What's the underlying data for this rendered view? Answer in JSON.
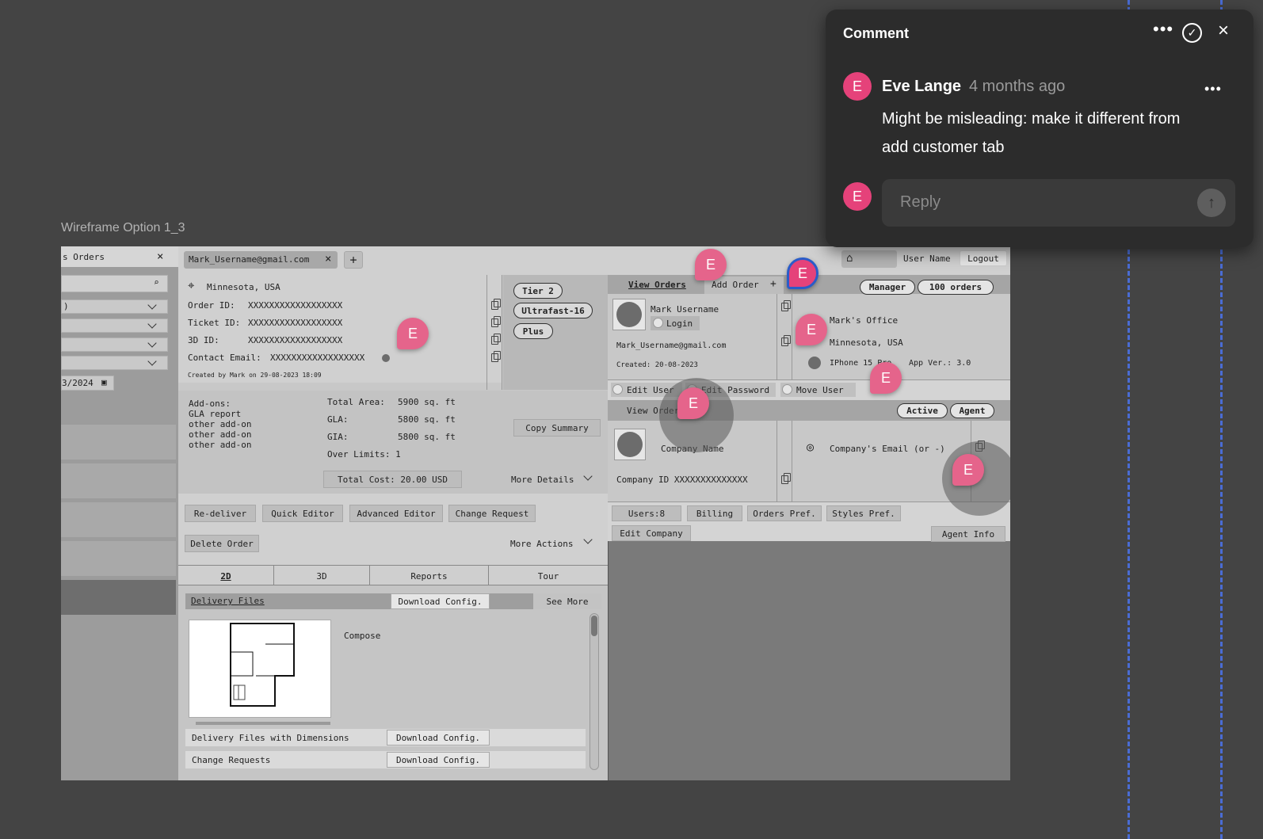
{
  "frame_label": "Wireframe Option 1_3",
  "left_panel": {
    "tab_label": "s Orders",
    "close": "×",
    "dropdown1": ")",
    "date": "3/2024"
  },
  "top": {
    "email_tab": "Mark_Username@gmail.com",
    "close": "×",
    "plus": "+",
    "user_name": "User Name",
    "logout": "Logout"
  },
  "order": {
    "location": "Minnesota, USA",
    "order_id_label": "Order ID:",
    "order_id": "XXXXXXXXXXXXXXXXXX",
    "ticket_label": "Ticket ID:",
    "ticket_id": "XXXXXXXXXXXXXXXXXX",
    "id3d_label": "3D ID:",
    "id3d": "XXXXXXXXXXXXXXXXXX",
    "email_label": "Contact Email:",
    "email": "XXXXXXXXXXXXXXXXXX",
    "created": "Created by Mark on 29-08-2023 18:09"
  },
  "badges": {
    "tier": "Tier 2",
    "speed": "Ultrafast-16",
    "plus": "Plus"
  },
  "summary": {
    "addons": [
      "Add-ons:",
      "GLA report",
      "other add-on",
      "other add-on",
      "other add-on"
    ],
    "total_area_label": "Total Area:",
    "total_area": "5900 sq. ft",
    "gla_label": "GLA:",
    "gla": "5800 sq. ft",
    "gia_label": "GIA:",
    "gia": "5800 sq. ft",
    "over_limits": "Over Limits: 1",
    "total_cost": "Total Cost: 20.00 USD",
    "copy_summary": "Copy Summary",
    "more_details": "More Details"
  },
  "actions": {
    "redeliver": "Re-deliver",
    "quick": "Quick Editor",
    "advanced": "Advanced Editor",
    "change": "Change Request",
    "delete": "Delete Order",
    "more": "More Actions"
  },
  "tabs": [
    "2D",
    "3D",
    "Reports",
    "Tour"
  ],
  "delivery": {
    "title": "Delivery Files",
    "download": "Download Config.",
    "see_more": "See More",
    "compose": "Compose",
    "dims_label": "Delivery Files with Dimensions",
    "dims_btn": "Download Config.",
    "change_label": "Change Requests",
    "change_btn": "Download Config."
  },
  "user": {
    "view_orders": "View Orders",
    "add_order": "Add Order",
    "add_icon": "+",
    "manager": "Manager",
    "orders": "100 orders",
    "name": "Mark Username",
    "login": "Login",
    "email": "Mark_Username@gmail.com",
    "created": "Created: 20-08-2023",
    "office": "Mark's Office",
    "location": "Minnesota, USA",
    "device": "IPhone 15 Pro",
    "app": "App Ver.: 3.0",
    "edit_user": "Edit User",
    "edit_password": "Edit Password",
    "move_user": "Move User"
  },
  "company": {
    "view_orders": "View Orders",
    "active": "Active",
    "agent": "Agent",
    "name": "Company Name",
    "email": "Company's Email (or -)",
    "id": "Company ID XXXXXXXXXXXXXX",
    "users": "Users:8",
    "billing": "Billing",
    "orders_pref": "Orders Pref.",
    "styles_pref": "Styles Pref.",
    "edit": "Edit Company",
    "agent_info": "Agent Info"
  },
  "marker_letter": "E",
  "comment": {
    "title": "Comment",
    "author": "Eve Lange",
    "time": "4 months ago",
    "text_line1": "Might be misleading: make it different from",
    "text_line2": "add customer tab",
    "reply_placeholder": "Reply",
    "avatar": "E"
  },
  "colors": {
    "marker": "#e5648b",
    "avatar": "#e5427a",
    "dash": "#4a6cd4"
  }
}
